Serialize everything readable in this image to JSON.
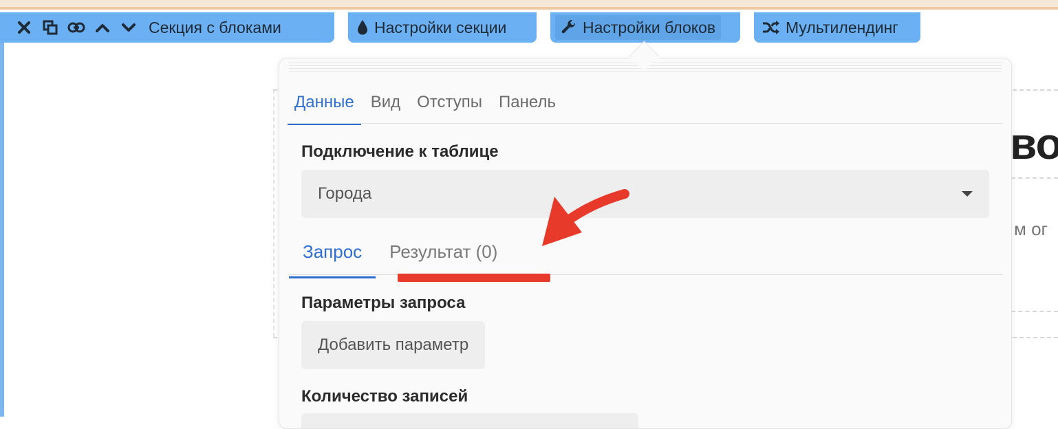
{
  "toolbar": {
    "section_title": "Секция с блоками",
    "tab_section_settings": "Настройки секции",
    "tab_block_settings": "Настройки блоков",
    "tab_multilanding": "Мультилендинг",
    "icons": [
      "close-icon",
      "copy-icon",
      "link-icon",
      "chevron-up-icon",
      "chevron-down-icon",
      "drop-icon",
      "wrench-icon",
      "shuffle-icon"
    ]
  },
  "panel": {
    "tabs": [
      {
        "label": "Данные",
        "active": true
      },
      {
        "label": "Вид",
        "active": false
      },
      {
        "label": "Отступы",
        "active": false
      },
      {
        "label": "Панель",
        "active": false
      }
    ],
    "table_connection_label": "Подключение к таблице",
    "table_select_value": "Города",
    "subtabs": [
      {
        "label": "Запрос",
        "active": true
      },
      {
        "label": "Результат (0)",
        "active": false
      }
    ],
    "query_params_label": "Параметры запроса",
    "add_param_button": "Добавить параметр",
    "records_count_label": "Количество записей"
  },
  "background": {
    "title_fragment": "во",
    "subtitle_fragment": "м ог"
  },
  "colors": {
    "toolbar_bg": "#6bb0f2",
    "accent": "#2f6fd1",
    "annotation": "#e83a2a"
  }
}
